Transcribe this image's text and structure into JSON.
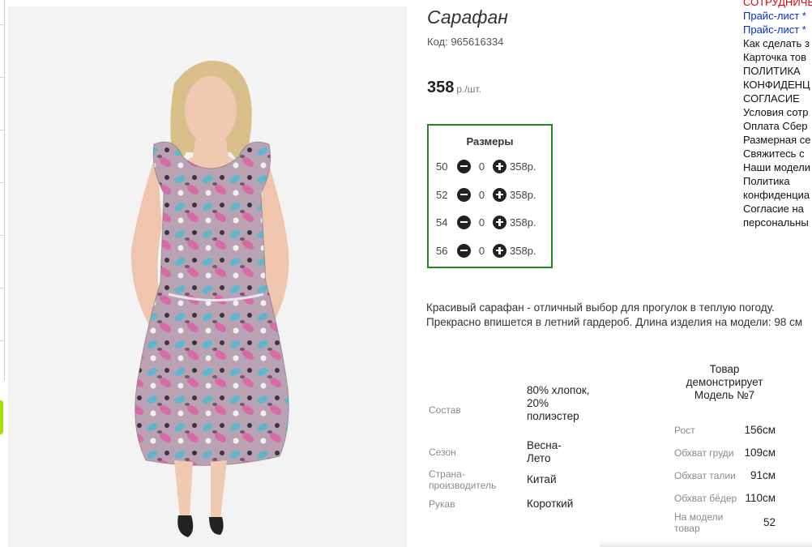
{
  "product": {
    "title": "Сарафан",
    "code": "Код: 965616334",
    "price": "358",
    "price_unit": "р./шт."
  },
  "sizes": {
    "title": "Размеры",
    "rows": [
      {
        "size": "50",
        "qty": "0",
        "price": "358р."
      },
      {
        "size": "52",
        "qty": "0",
        "price": "358р."
      },
      {
        "size": "54",
        "qty": "0",
        "price": "358р."
      },
      {
        "size": "56",
        "qty": "0",
        "price": "358р."
      }
    ]
  },
  "description": "Красивый сарафан - отличный выбор для прогулок в теплую погоду. Прекрасно впишется в летний гардероб. Длина изделия на модели: 98 см",
  "specs": [
    {
      "label": "Состав",
      "value": "80% хлопок, 20% полиэстер"
    },
    {
      "label": "Сезон",
      "value": "Весна-Лето"
    },
    {
      "label": "Страна-производитель",
      "value": "Китай"
    },
    {
      "label": "Рукав",
      "value": "Короткий"
    }
  ],
  "model": {
    "heading": "Товар демонстрирует Модель №7",
    "measurements": [
      {
        "label": "Рост",
        "value": "156см"
      },
      {
        "label": "Обхват груди",
        "value": "109см"
      },
      {
        "label": "Обхват талии",
        "value": "91см"
      },
      {
        "label": "Обхват бёдер",
        "value": "110см"
      },
      {
        "label": "На модели товар",
        "value": "52"
      }
    ]
  },
  "menu": [
    {
      "text": "СОТРУДНИЧЕ",
      "color": "red"
    },
    {
      "text": "Прайс-лист *",
      "color": "blue"
    },
    {
      "text": "Прайс-лист *",
      "color": "blue"
    },
    {
      "text": "Как сделать з",
      "color": "black"
    },
    {
      "text": "Карточка тов",
      "color": "black"
    },
    {
      "text": "ПОЛИТИКА",
      "color": "black"
    },
    {
      "text": "КОНФИДЕНЦ",
      "color": "black"
    },
    {
      "text": "СОГЛАСИЕ",
      "color": "black"
    },
    {
      "text": "Условия сотр",
      "color": "black"
    },
    {
      "text": "Оплата Сбер",
      "color": "black"
    },
    {
      "text": "Размерная се",
      "color": "black"
    },
    {
      "text": "Свяжитесь с",
      "color": "black"
    },
    {
      "text": "Наши модели",
      "color": "black"
    },
    {
      "text": "Политика",
      "color": "black"
    },
    {
      "text": "конфиденциа",
      "color": "black"
    },
    {
      "text": "Согласие на",
      "color": "black"
    },
    {
      "text": "персональны",
      "color": "black"
    }
  ],
  "colors": {
    "sizes_border": "#1e8a1e",
    "menu_red": "#e00000",
    "menu_blue": "#0030c8",
    "green_tab": "#a6e000"
  }
}
